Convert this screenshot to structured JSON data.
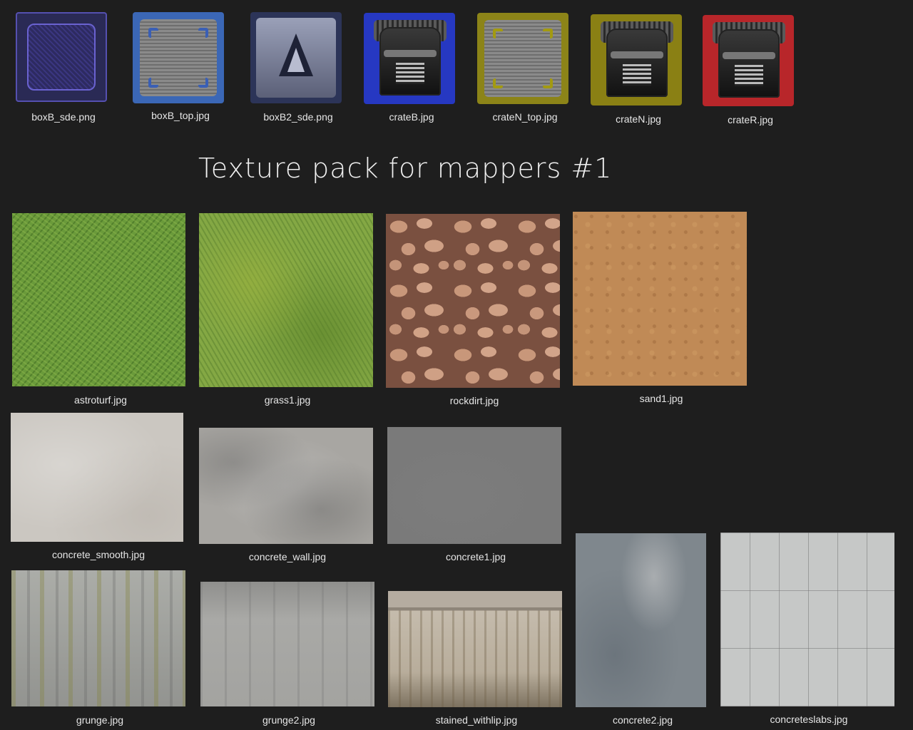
{
  "title": "Texture pack for mappers #1",
  "icons": [
    {
      "label": "boxB_sde.png"
    },
    {
      "label": "boxB_top.jpg"
    },
    {
      "label": "boxB2_sde.png"
    },
    {
      "label": "crateB.jpg"
    },
    {
      "label": "crateN_top.jpg"
    },
    {
      "label": "crateN.jpg"
    },
    {
      "label": "crateR.jpg"
    }
  ],
  "textures": [
    {
      "label": "astroturf.jpg"
    },
    {
      "label": "grass1.jpg"
    },
    {
      "label": "rockdirt.jpg"
    },
    {
      "label": "sand1.jpg"
    },
    {
      "label": "concrete_smooth.jpg"
    },
    {
      "label": "concrete_wall.jpg"
    },
    {
      "label": "concrete1.jpg"
    },
    {
      "label": "grunge.jpg"
    },
    {
      "label": "grunge2.jpg"
    },
    {
      "label": "stained_withlip.jpg"
    },
    {
      "label": "concrete2.jpg"
    },
    {
      "label": "concreteslabs.jpg"
    }
  ],
  "colors": {
    "background": "#1e1e1e",
    "blue_accent": "#2f3fb8",
    "olive_accent": "#8c8418",
    "red_accent": "#b8262a"
  }
}
